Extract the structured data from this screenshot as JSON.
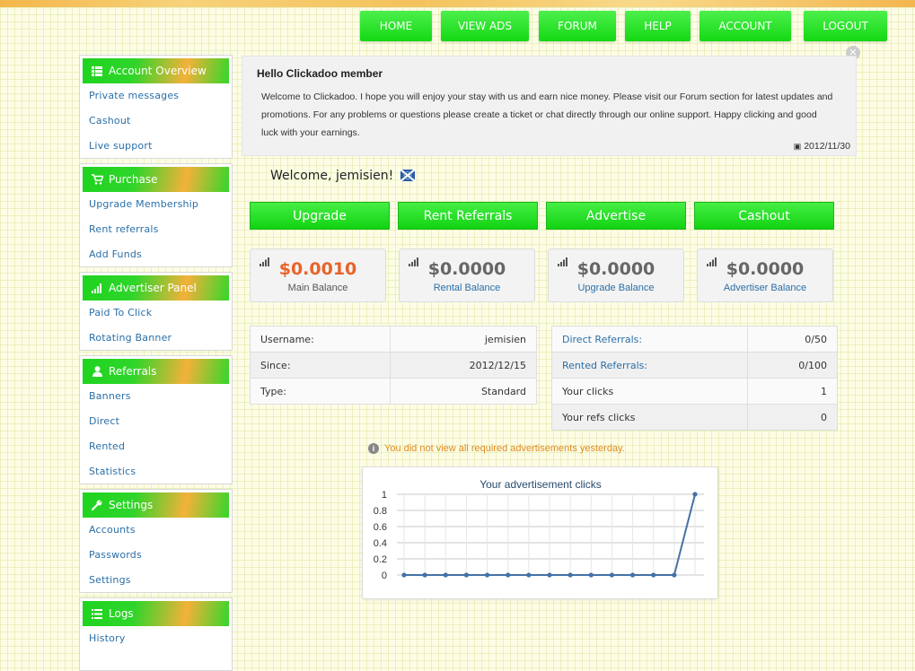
{
  "nav": [
    "HOME",
    "VIEW ADS",
    "FORUM",
    "HELP",
    "ACCOUNT",
    "LOGOUT"
  ],
  "sidebar": [
    {
      "title": "Account Overview",
      "icon": "th-list-icon",
      "items": [
        "Private messages",
        "Cashout",
        "Live support"
      ]
    },
    {
      "title": "Purchase",
      "icon": "shopping-cart-icon",
      "items": [
        "Upgrade Membership",
        "Rent referrals",
        "Add Funds"
      ]
    },
    {
      "title": "Advertiser Panel",
      "icon": "signal-icon",
      "items": [
        "Paid To Click",
        "Rotating Banner"
      ]
    },
    {
      "title": "Referrals",
      "icon": "user-icon",
      "items": [
        "Banners",
        "Direct",
        "Rented",
        "Statistics"
      ]
    },
    {
      "title": "Settings",
      "icon": "wrench-icon",
      "items": [
        "Accounts",
        "Passwords",
        "Settings"
      ]
    },
    {
      "title": "Logs",
      "icon": "list-icon",
      "items": [
        "History"
      ]
    }
  ],
  "message": {
    "title": "Hello Clickadoo member",
    "body": "Welcome to Clickadoo. I hope you will enjoy your stay with us and earn nice money. Please visit our Forum section for latest updates and promotions. For any problems or questions please create a ticket or chat directly through our online support. Happy clicking and good luck with your earnings.",
    "date": "2012/11/30"
  },
  "welcome": "Welcome, jemisien!",
  "actions": [
    "Upgrade",
    "Rent Referrals",
    "Advertise",
    "Cashout"
  ],
  "balances": [
    {
      "value": "$0.0010",
      "label": "Main Balance",
      "color": "#e8632a"
    },
    {
      "value": "$0.0000",
      "label": "Rental Balance",
      "color": "#666666"
    },
    {
      "value": "$0.0000",
      "label": "Upgrade Balance",
      "color": "#666666"
    },
    {
      "value": "$0.0000",
      "label": "Advertiser Balance",
      "color": "#666666"
    }
  ],
  "user_info": [
    {
      "label": "Username:",
      "value": "jemisien"
    },
    {
      "label": "Since:",
      "value": "2012/12/15"
    },
    {
      "label": "Type:",
      "value": "Standard"
    }
  ],
  "ref_info": [
    {
      "label": "Direct Referrals:",
      "value": "0/50"
    },
    {
      "label": "Rented Referrals:",
      "value": "0/100"
    },
    {
      "label": "Your clicks",
      "value": "1"
    },
    {
      "label": "Your refs clicks",
      "value": "0"
    }
  ],
  "notice": "You did not view all required advertisements yesterday.",
  "chart_data": {
    "type": "line",
    "title": "Your advertisement clicks",
    "x": [
      1,
      2,
      3,
      4,
      5,
      6,
      7,
      8,
      9,
      10,
      11,
      12,
      13,
      14,
      15
    ],
    "values": [
      0,
      0,
      0,
      0,
      0,
      0,
      0,
      0,
      0,
      0,
      0,
      0,
      0,
      0,
      1
    ],
    "ylim": [
      0,
      1
    ],
    "yticks": [
      "0",
      "0.2",
      "0.4",
      "0.6",
      "0.8",
      "1"
    ],
    "grid": true,
    "color": "#4572a7"
  }
}
